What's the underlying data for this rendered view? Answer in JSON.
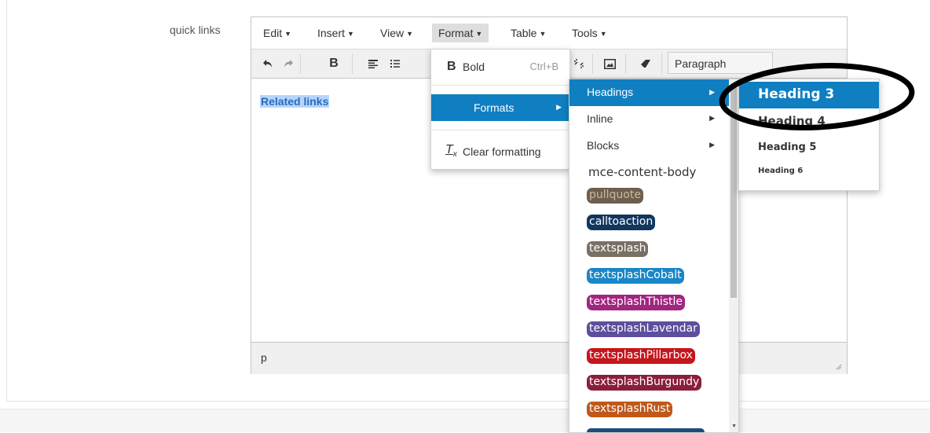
{
  "field": {
    "label": "quick links"
  },
  "menubar": {
    "items": [
      {
        "label": "Edit"
      },
      {
        "label": "Insert"
      },
      {
        "label": "View"
      },
      {
        "label": "Format"
      },
      {
        "label": "Table"
      },
      {
        "label": "Tools"
      }
    ]
  },
  "toolbar": {
    "paragraph_label": "Paragraph",
    "icons": [
      "undo-icon",
      "redo-icon",
      "bold-icon",
      "align-left-icon",
      "bullet-list-icon",
      "unlink-icon",
      "image-icon",
      "eraser-icon"
    ]
  },
  "content": {
    "selected_text": "Related links"
  },
  "status": {
    "path": "p"
  },
  "format_menu": {
    "bold_glyph": "B",
    "bold_label": "Bold",
    "bold_shortcut": "Ctrl+B",
    "formats_label": "Formats",
    "clear_glyph": "T",
    "clear_sub": "x",
    "clear_label": "Clear formatting"
  },
  "formats_submenu": {
    "items": [
      {
        "label": "Headings",
        "has_submenu": true
      },
      {
        "label": "Inline",
        "has_submenu": true
      },
      {
        "label": "Blocks",
        "has_submenu": true
      },
      {
        "label": "mce-content-body"
      }
    ],
    "styles": [
      {
        "label": "pullquote",
        "bg": "#6f5e4d",
        "fg": "#c9b9a2"
      },
      {
        "label": "calltoaction",
        "bg": "#12375e",
        "fg": "#ffffff"
      },
      {
        "label": "textsplash",
        "bg": "#7a6f64",
        "fg": "#ffffff"
      },
      {
        "label": "textsplashCobalt",
        "bg": "#1a86c7",
        "fg": "#ffffff"
      },
      {
        "label": "textsplashThistle",
        "bg": "#a0267f",
        "fg": "#ffffff"
      },
      {
        "label": "textsplashLavendar",
        "bg": "#5e4e9e",
        "fg": "#ffffff"
      },
      {
        "label": "textsplashPillarbox",
        "bg": "#c4161c",
        "fg": "#ffffff"
      },
      {
        "label": "textsplashBurgundy",
        "bg": "#8a1f3c",
        "fg": "#ffffff"
      },
      {
        "label": "textsplashRust",
        "bg": "#c0581a",
        "fg": "#ffffff"
      }
    ]
  },
  "headings_submenu": {
    "items": [
      {
        "label": "Heading 3"
      },
      {
        "label": "Heading 4"
      },
      {
        "label": "Heading 5"
      },
      {
        "label": "Heading 6"
      }
    ]
  },
  "colors": {
    "accent": "#0f7fc2"
  }
}
